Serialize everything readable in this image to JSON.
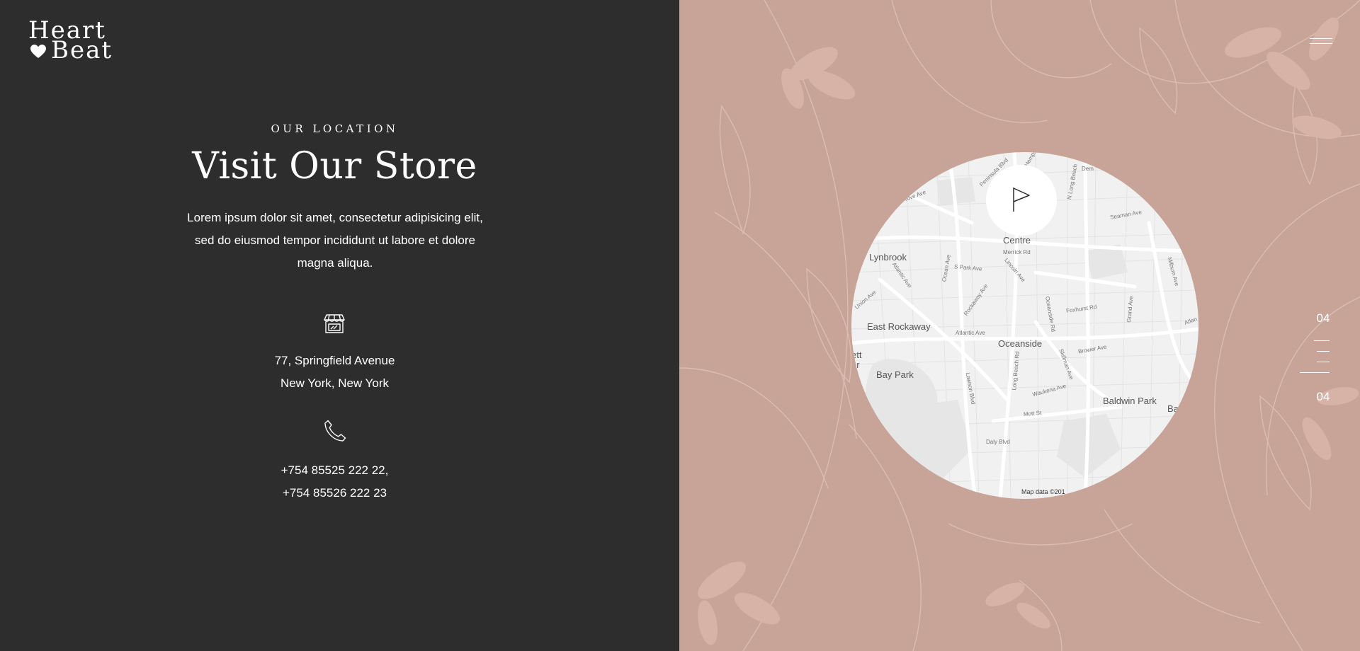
{
  "brand": {
    "logo_line1": "Heart",
    "logo_line2": "Beat",
    "logo_icon": "heart-icon"
  },
  "location": {
    "eyebrow": "OUR LOCATION",
    "title": "Visit Our Store",
    "intro": "Lorem ipsum dolor sit amet, consectetur adipisicing elit, sed do eiusmod tempor incididunt ut labore et dolore magna aliqua.",
    "store_icon": "store-icon",
    "address_line1": "77, Springfield Avenue",
    "address_line2": "New York, New York",
    "phone_icon": "phone-icon",
    "phone_line1": "+754 85525 222 22,",
    "phone_line2": "+754 85526 222 23"
  },
  "map": {
    "pin_icon": "flag-icon",
    "places": {
      "lynbrook": "Lynbrook",
      "east_rockaway": "East Rockaway",
      "oceanside": "Oceanside",
      "bay_park": "Bay Park",
      "baldwin_park": "Baldwin Park",
      "centre": "Centre",
      "ett": "ett",
      "or": "or",
      "ba": "Ba"
    },
    "streets": {
      "merrick": "Merrick Rd",
      "s_park": "S Park Ave",
      "lincoln": "Lincoln Ave",
      "ocean": "Ocean Ave",
      "atlantic1": "Atlantic Ave",
      "atlantic2": "Atlantic Ave",
      "atlantic3": "Atlan",
      "union": "Union Ave",
      "rockaway": "Rockaway Ave",
      "oceanside_rd": "Oceanside Rd",
      "foxhurst": "Foxhurst Rd",
      "grand": "Grand Ave",
      "milburn": "Milburn Ave",
      "seaman": "Seaman Ave",
      "n_long_beach": "N Long Beach",
      "peninsula": "Peninsula Blvd",
      "hempst": "Hempst",
      "demo": "Dem",
      "skillman": "Skillman Ave",
      "brower": "Brower Ave",
      "waukena": "Waukena Ave",
      "mott": "Mott St",
      "long_beach_rd": "Long Beach Rd",
      "lawson": "Lawson Blvd",
      "daly": "Daly Blvd",
      "grove": "rove Ave"
    },
    "attribution": "Map data ©201"
  },
  "nav": {
    "menu_icon": "menu-icon",
    "current_page": "04",
    "total_pages": "04"
  },
  "colors": {
    "dark_panel": "#2d2d2d",
    "rose_panel": "#c7a497",
    "map_background": "#f1f1f1",
    "text": "#ffffff"
  }
}
